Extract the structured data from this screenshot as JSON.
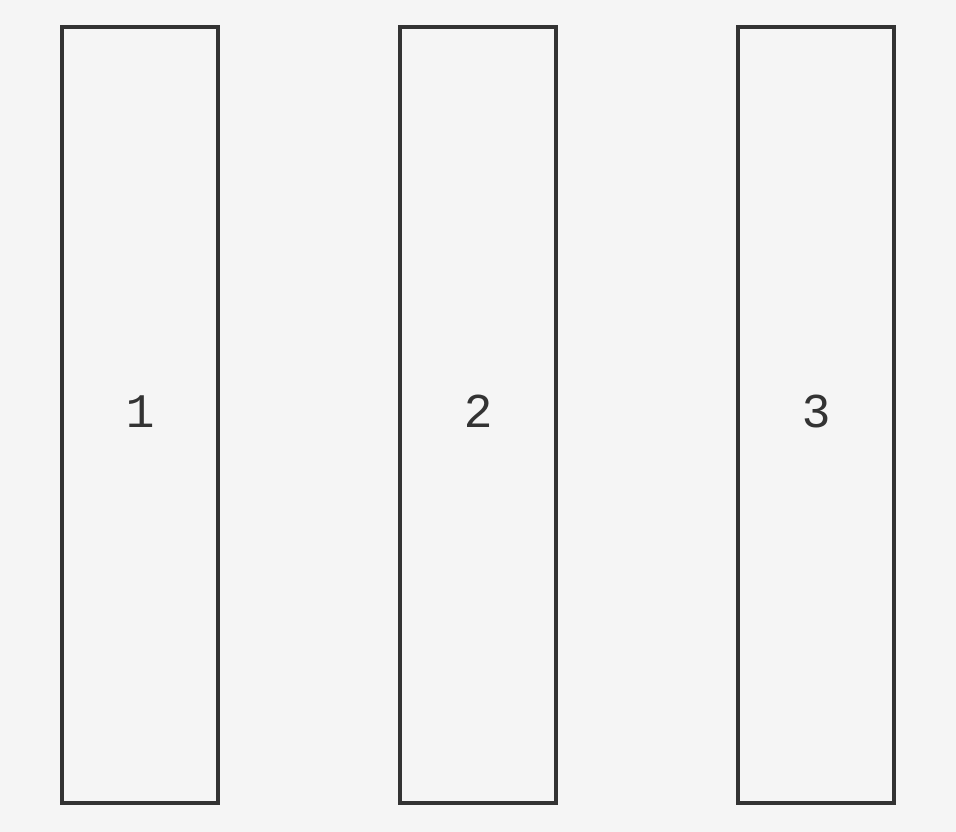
{
  "boxes": [
    {
      "label": "1"
    },
    {
      "label": "2"
    },
    {
      "label": "3"
    }
  ]
}
